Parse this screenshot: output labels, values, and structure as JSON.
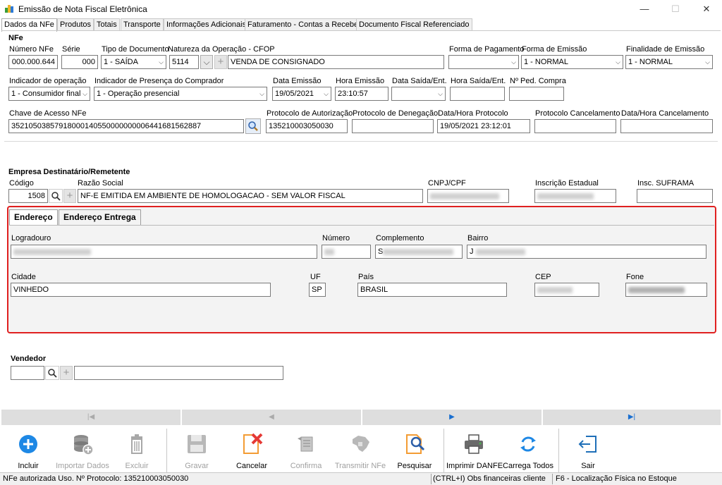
{
  "window": {
    "title": "Emissão de Nota Fiscal Eletrônica",
    "minimize": "—",
    "maximize": "☐",
    "close": "✕"
  },
  "tabs": [
    "Dados da NFe",
    "Produtos",
    "Totais",
    "Transporte",
    "Informações Adicionais",
    "Faturamento - Contas a Receber",
    "Documento Fiscal Referenciado"
  ],
  "nfe": {
    "section_title": "NFe",
    "numero_label": "Número NFe",
    "numero_value": "000.000.644",
    "serie_label": "Série",
    "serie_value": "000",
    "tipo_label": "Tipo de Documento",
    "tipo_value": "1 - SAÍDA",
    "natureza_label": "Natureza da Operação - CFOP",
    "cfop_value": "5114",
    "natureza_value": "VENDA DE CONSIGNADO",
    "forma_pagamento_label": "Forma de Pagamento",
    "forma_pagamento_value": "",
    "forma_emissao_label": "Forma de Emissão",
    "forma_emissao_value": "1 - NORMAL",
    "finalidade_label": "Finalidade de Emissão",
    "finalidade_value": "1 - NORMAL",
    "indicador_operacao_label": "Indicador de operação",
    "indicador_operacao_value": "1 - Consumidor final",
    "indicador_presenca_label": "Indicador de Presença do Comprador",
    "indicador_presenca_value": "1 - Operação presencial",
    "data_emissao_label": "Data Emissão",
    "data_emissao_value": "19/05/2021",
    "hora_emissao_label": "Hora Emissão",
    "hora_emissao_value": "23:10:57",
    "data_saida_label": "Data Saída/Ent.",
    "data_saida_value": "",
    "hora_saida_label": "Hora Saída/Ent.",
    "hora_saida_value": "",
    "pedido_label": "Nº Ped. Compra",
    "pedido_value": "",
    "chave_label": "Chave de Acesso NFe",
    "chave_value": "35210503857918000140550000000006441681562887",
    "protocolo_aut_label": "Protocolo de Autorização",
    "protocolo_aut_value": "135210003050030",
    "protocolo_den_label": "Protocolo de Denegação",
    "protocolo_den_value": "",
    "data_protocolo_label": "Data/Hora Protocolo",
    "data_protocolo_value": "19/05/2021 23:12:01",
    "protocolo_canc_label": "Protocolo Cancelamento",
    "protocolo_canc_value": "",
    "data_canc_label": "Data/Hora Cancelamento",
    "data_canc_value": ""
  },
  "empresa": {
    "section_title": "Empresa Destinatário/Remetente",
    "codigo_label": "Código",
    "codigo_value": "1508",
    "razao_label": "Razão Social",
    "razao_value": "NF-E EMITIDA EM AMBIENTE DE HOMOLOGACAO - SEM VALOR FISCAL",
    "cnpj_label": "CNPJ/CPF",
    "ie_label": "Inscrição Estadual",
    "suframa_label": "Insc. SUFRAMA",
    "suframa_value": ""
  },
  "endereco": {
    "tab_endereco": "Endereço",
    "tab_entrega": "Endereço Entrega",
    "logradouro_label": "Logradouro",
    "numero_label": "Número",
    "complemento_label": "Complemento",
    "bairro_label": "Bairro",
    "bairro_prefix": "J",
    "complemento_prefix": "S",
    "cidade_label": "Cidade",
    "cidade_value": "VINHEDO",
    "uf_label": "UF",
    "uf_value": "SP",
    "pais_label": "País",
    "pais_value": "BRASIL",
    "cep_label": "CEP",
    "fone_label": "Fone"
  },
  "vendedor": {
    "section_title": "Vendedor",
    "codigo_value": "",
    "nome_value": ""
  },
  "navigation": {
    "first": "|◀",
    "prev": "◀",
    "next": "▶",
    "last": "▶|"
  },
  "toolbar": {
    "incluir": "Incluir",
    "importar": "Importar Dados",
    "excluir": "Excluir",
    "gravar": "Gravar",
    "cancelar": "Cancelar",
    "confirma": "Confirma",
    "transmitir": "Transmitir NFe",
    "pesquisar": "Pesquisar",
    "imprimir": "Imprimir DANFE",
    "carrega": "Carrega Todos",
    "sair": "Sair"
  },
  "status": {
    "left": "NFe autorizada Uso. Nº Protocolo: 135210003050030",
    "middle": "(CTRL+I) Obs financeiras cliente",
    "right": "F6 - Localização Física no Estoque"
  },
  "colors": {
    "highlight_border": "#e02020",
    "nav_arrow": "#1a6fd0",
    "incluir_blue": "#1e88e5",
    "cancel_red": "#e53935",
    "doc_orange": "#f39c34"
  }
}
